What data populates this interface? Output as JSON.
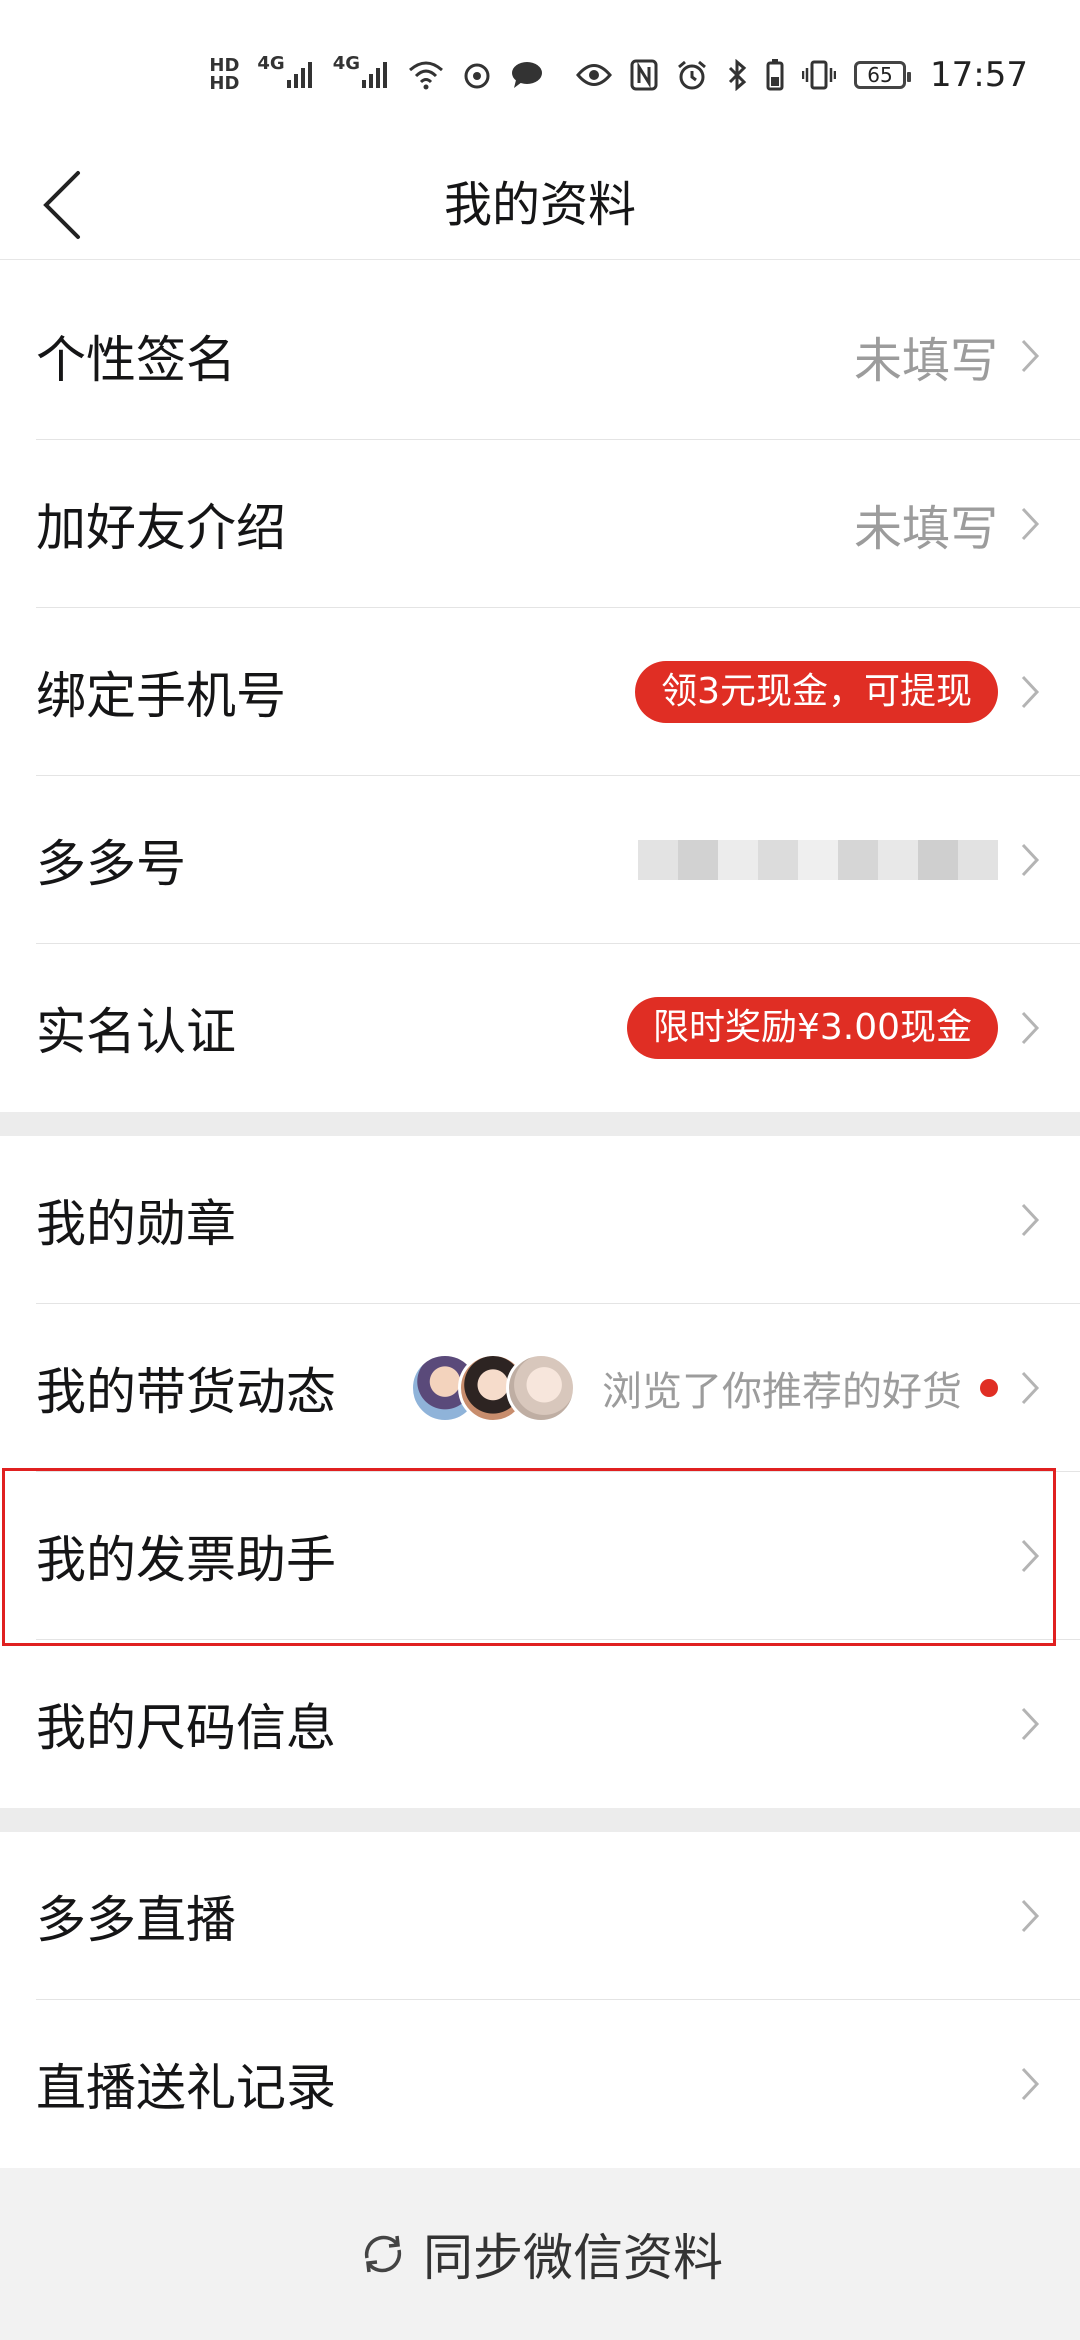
{
  "status_bar": {
    "network_labels": [
      "HD",
      "HD"
    ],
    "signal_labels": [
      "4G",
      "4G"
    ],
    "battery_level": "65",
    "time": "17:57"
  },
  "nav": {
    "title": "我的资料"
  },
  "sections": [
    {
      "rows": [
        {
          "label": "个性签名",
          "value": "未填写",
          "type": "text"
        },
        {
          "label": "加好友介绍",
          "value": "未填写",
          "type": "text"
        },
        {
          "label": "绑定手机号",
          "value": "领3元现金，可提现",
          "type": "pill"
        },
        {
          "label": "多多号",
          "value": "",
          "type": "redacted"
        },
        {
          "label": "实名认证",
          "value": "限时奖励¥3.00现金",
          "type": "pill"
        }
      ]
    },
    {
      "rows": [
        {
          "label": "我的勋章",
          "type": "plain"
        },
        {
          "label": "我的带货动态",
          "value": "浏览了你推荐的好货",
          "type": "activity"
        },
        {
          "label": "我的发票助手",
          "type": "plain",
          "highlighted": true
        },
        {
          "label": "我的尺码信息",
          "type": "plain"
        }
      ]
    },
    {
      "rows": [
        {
          "label": "多多直播",
          "type": "plain"
        },
        {
          "label": "直播送礼记录",
          "type": "plain"
        }
      ]
    }
  ],
  "footer": {
    "label": "同步微信资料"
  },
  "colors": {
    "accent_red": "#e02e24",
    "highlight_border": "#e02020",
    "gray_text": "#9c9c9c"
  }
}
